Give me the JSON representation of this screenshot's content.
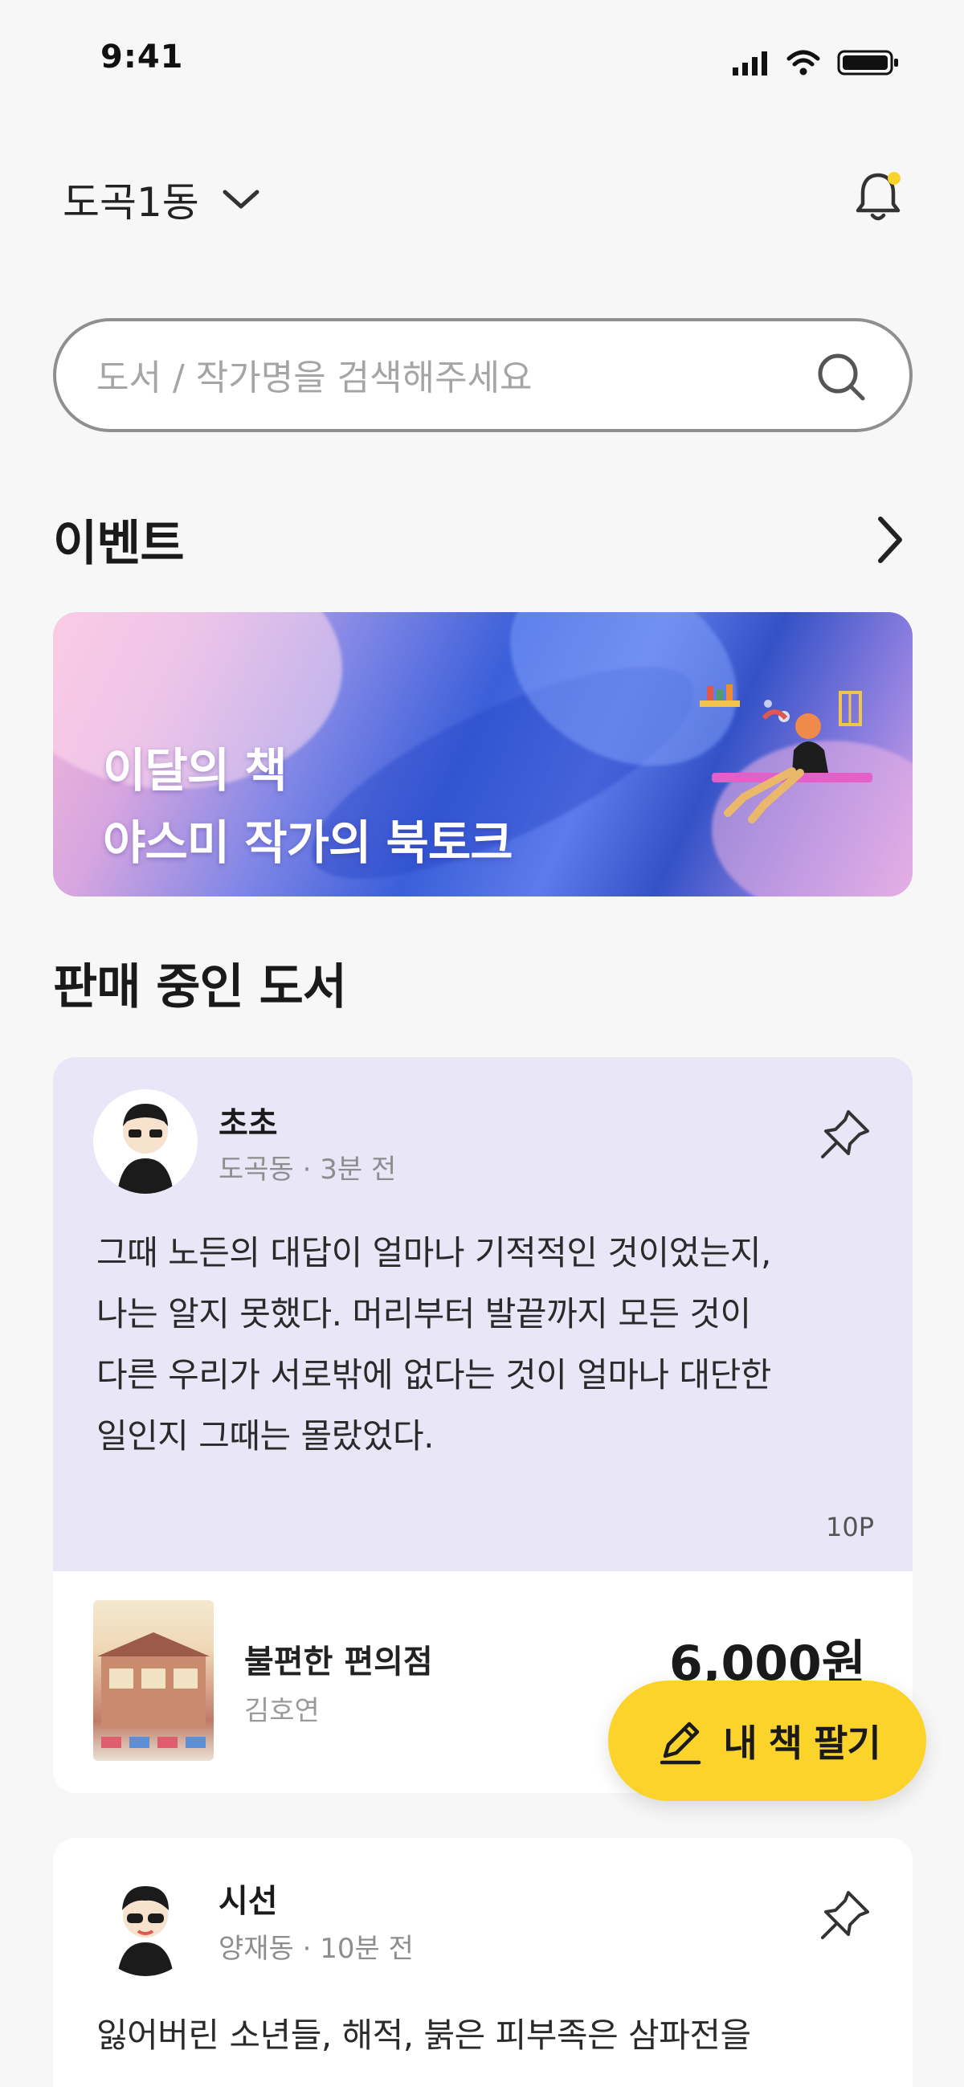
{
  "status_bar": {
    "time": "9:41"
  },
  "header": {
    "location": "도곡1동"
  },
  "search": {
    "placeholder": "도서 / 작가명을 검색해주세요"
  },
  "events": {
    "title": "이벤트",
    "banner": {
      "line1": "이달의 책",
      "line2": "야스미 작가의 북토크"
    }
  },
  "books_section": {
    "title": "판매 중인 도서"
  },
  "posts": [
    {
      "author": "초초",
      "meta": "도곡동 · 3분 전",
      "quote_lines": [
        "그때 노든의 대답이 얼마나 기적적인 것이었는지,",
        "나는 알지 못했다. 머리부터 발끝까지 모든 것이",
        "다른 우리가 서로밖에 없다는 것이 얼마나 대단한",
        "일인지 그때는 몰랐었다."
      ],
      "page": "10P",
      "book": {
        "title": "불편한 편의점",
        "author": "김호연",
        "price": "6,000원"
      }
    },
    {
      "author": "시선",
      "meta": "양재동 · 10분 전",
      "quote_lines": [
        "잃어버린 소년들, 해적, 붉은 피부족은 삼파전을"
      ]
    }
  ],
  "fab": {
    "label": "내 책 팔기"
  },
  "colors": {
    "accent": "#fbd32a",
    "card_highlight": "#e9e6f8",
    "background": "#f7f7f7"
  },
  "icons": [
    "signal-icon",
    "wifi-icon",
    "battery-icon",
    "chevron-down-icon",
    "bell-icon",
    "search-icon",
    "chevron-right-icon",
    "pin-icon",
    "pencil-icon"
  ]
}
